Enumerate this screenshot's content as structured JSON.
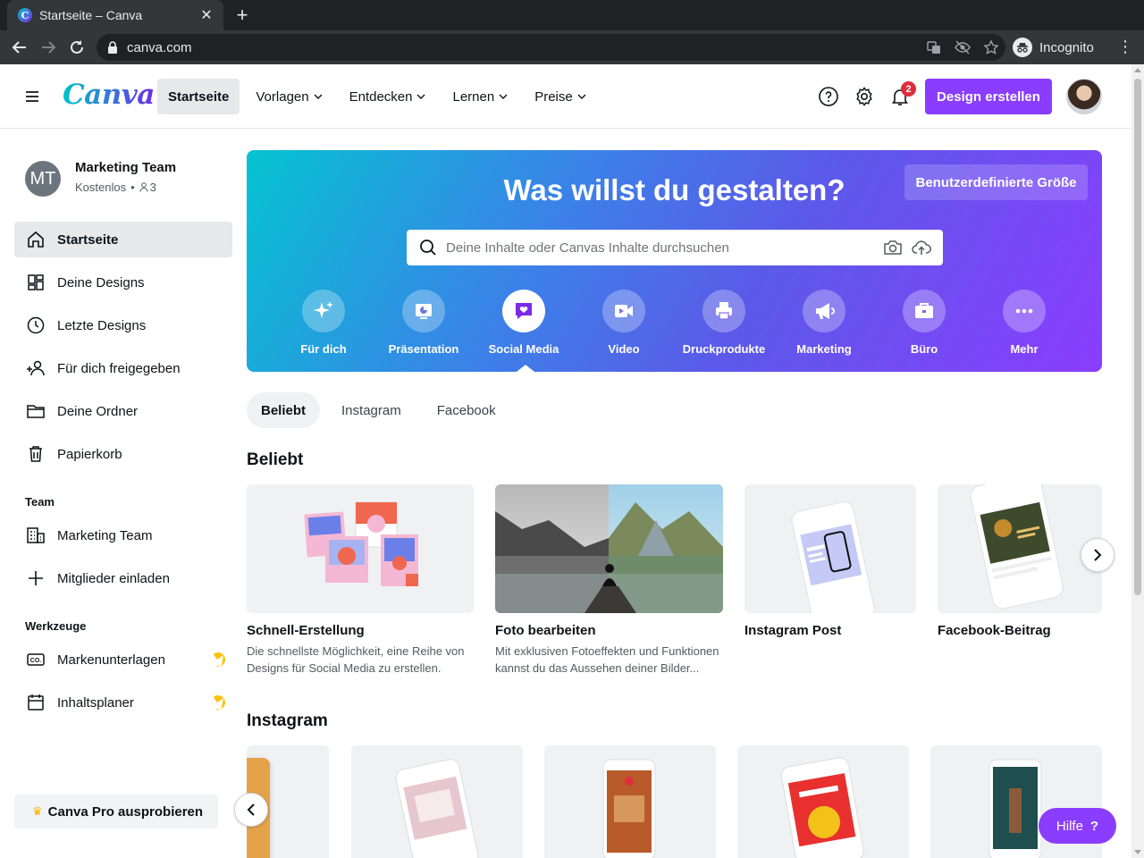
{
  "browser": {
    "tab_title": "Startseite – Canva",
    "url": "canva.com",
    "profile_label": "Incognito"
  },
  "header": {
    "logo": "Canva",
    "nav": [
      {
        "label": "Startseite",
        "active": true
      },
      {
        "label": "Vorlagen"
      },
      {
        "label": "Entdecken"
      },
      {
        "label": "Lernen"
      },
      {
        "label": "Preise"
      }
    ],
    "notification_count": "2",
    "create_button": "Design erstellen"
  },
  "sidebar": {
    "team_initials": "MT",
    "team_name": "Marketing Team",
    "team_plan": "Kostenlos",
    "team_members": "3",
    "items": [
      {
        "label": "Startseite",
        "icon": "home-icon",
        "active": true
      },
      {
        "label": "Deine Designs",
        "icon": "grid-icon"
      },
      {
        "label": "Letzte Designs",
        "icon": "clock-icon"
      },
      {
        "label": "Für dich freigegeben",
        "icon": "shared-users-icon"
      },
      {
        "label": "Deine Ordner",
        "icon": "folder-icon"
      },
      {
        "label": "Papierkorb",
        "icon": "trash-icon"
      }
    ],
    "team_section": "Team",
    "team_items": [
      {
        "label": "Marketing Team",
        "icon": "building-icon"
      },
      {
        "label": "Mitglieder einladen",
        "icon": "plus-icon"
      }
    ],
    "tools_section": "Werkzeuge",
    "tools_items": [
      {
        "label": "Markenunterlagen",
        "icon": "brand-kit-icon"
      },
      {
        "label": "Inhaltsplaner",
        "icon": "calendar-icon"
      }
    ],
    "pro_button": "Canva Pro ausprobieren"
  },
  "hero": {
    "title": "Was willst du gestalten?",
    "custom_size": "Benutzerdefinierte Größe",
    "search_placeholder": "Deine Inhalte oder Canvas Inhalte durchsuchen",
    "categories": [
      {
        "label": "Für dich",
        "icon": "sparkle-icon"
      },
      {
        "label": "Präsentation",
        "icon": "presentation-icon"
      },
      {
        "label": "Social Media",
        "icon": "heart-bubble-icon",
        "active": true
      },
      {
        "label": "Video",
        "icon": "video-icon"
      },
      {
        "label": "Druckprodukte",
        "icon": "printer-icon"
      },
      {
        "label": "Marketing",
        "icon": "megaphone-icon"
      },
      {
        "label": "Büro",
        "icon": "briefcase-icon"
      },
      {
        "label": "Mehr",
        "icon": "more-icon"
      }
    ]
  },
  "subtabs": [
    "Beliebt",
    "Instagram",
    "Facebook"
  ],
  "popular": {
    "title": "Beliebt",
    "cards": [
      {
        "title": "Schnell-Erstellung",
        "desc": "Die schnellste Möglichkeit, eine Reihe von Designs für Social Media zu erstellen."
      },
      {
        "title": "Foto bearbeiten",
        "desc": "Mit exklusiven Fotoeffekten und Funktionen kannst du das Aussehen deiner Bilder..."
      },
      {
        "title": "Instagram Post",
        "desc": ""
      },
      {
        "title": "Facebook-Beitrag",
        "desc": ""
      }
    ]
  },
  "instagram": {
    "title": "Instagram"
  },
  "help_button": "Hilfe",
  "colors": {
    "brand_purple": "#8b3dff",
    "canva_teal": "#00c4cc",
    "badge_red": "#e02d3c"
  }
}
